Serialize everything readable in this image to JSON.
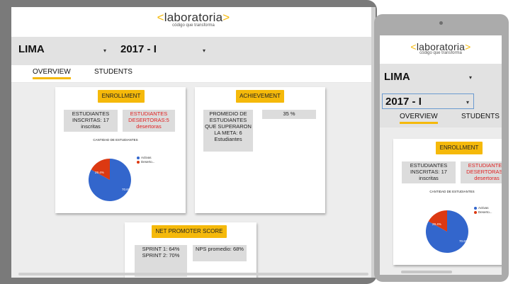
{
  "brand": {
    "name": "laboratoria",
    "bracket_open": "<",
    "bracket_close": ">",
    "tagline": "código que transforma"
  },
  "filters": {
    "sede": "LIMA",
    "generacion": "2017 - I"
  },
  "tabs": [
    {
      "label": "OVERVIEW",
      "active": true
    },
    {
      "label": "STUDENTS",
      "active": false
    }
  ],
  "enrollment": {
    "title": "ENROLLMENT",
    "inscritas": "ESTUDIANTES INSCRITAS: 17 inscritas",
    "desertoras": "ESTUDIANTES DESERTORAS:5 desertoras",
    "chart_title": "CANTIDAD DE ESTUDIANTES"
  },
  "achievement": {
    "title": "ACHIEVEMENT",
    "meta": "PROMEDIO DE ESTUDIANTES QUE SUPERARON LA META: 6 Estudiantes",
    "percent": "35 %"
  },
  "nps": {
    "title": "NET PROMOTER SCORE",
    "sprints": "SPRINT 1: 64% SPRINT 2: 70%",
    "promedio": "NPS promedio: 68%"
  },
  "colors": {
    "accent": "#f5b90a",
    "activas": "#3366cc",
    "desertoras": "#dc3912"
  },
  "chart_data": {
    "type": "pie",
    "title": "CANTIDAD DE ESTUDIANTES",
    "series": [
      {
        "name": "Activas",
        "value": 70.6,
        "label": "70.6%"
      },
      {
        "name": "Deserto...",
        "value": 29.4,
        "label": "29.4%"
      }
    ]
  }
}
